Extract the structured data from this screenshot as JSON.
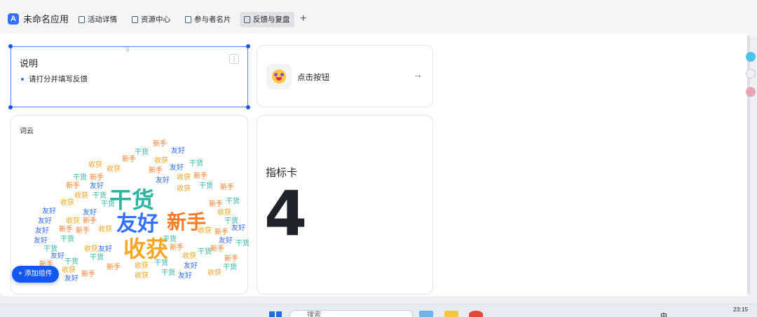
{
  "app": {
    "title": "未命名应用",
    "logo_icon": "app-logo-icon"
  },
  "tabs": [
    {
      "label": "活动详情",
      "active": false
    },
    {
      "label": "资源中心",
      "active": false
    },
    {
      "label": "参与者名片",
      "active": false
    },
    {
      "label": "反馈与复盘",
      "active": true
    }
  ],
  "tab_add": "+",
  "notes_card": {
    "title": "说明",
    "bullet": "请打分并填写反馈",
    "more": "⋮",
    "drag": "⠿"
  },
  "button_card": {
    "label": "点击按钮",
    "arrow": "→"
  },
  "wordcloud_card": {
    "title": "词云",
    "words": [
      "收获",
      "友好",
      "新手",
      "干货"
    ],
    "colors": [
      "#f5a623",
      "#3370ff",
      "#f77b24",
      "#2bb5a0"
    ]
  },
  "metric_card": {
    "label": "指标卡",
    "value": "4"
  },
  "add_widget": "+ 添加组件",
  "taskbar": {
    "search_placeholder": "搜索",
    "ime": "中",
    "clock": "23:15"
  },
  "colors": {
    "accent": "#1456f0",
    "selection": "#4d7fff"
  }
}
